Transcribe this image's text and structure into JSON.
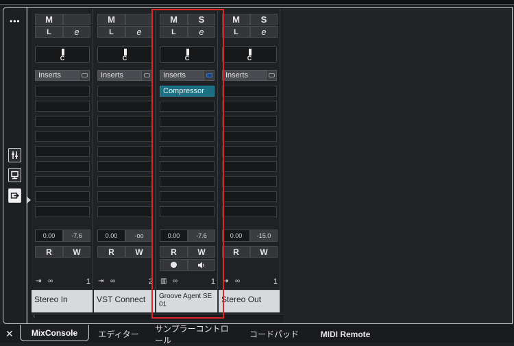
{
  "leftbar": {
    "menu_glyph": "•••",
    "buttons": [
      "eq-sliders-icon",
      "monitor-icon",
      "routing-icon"
    ]
  },
  "labels": {
    "mute": "M",
    "solo": "S",
    "listen": "L",
    "edit": "e",
    "read": "R",
    "write": "W",
    "inserts": "Inserts"
  },
  "channels": [
    {
      "name": "Stereo In",
      "pan": "C",
      "volume": "0.00",
      "peak": "-7.6",
      "number": "1",
      "type_icon": "input-icon",
      "has_solo": false,
      "plugin": "",
      "has_record": false
    },
    {
      "name": "VST Connect",
      "pan": "C",
      "volume": "0.00",
      "peak": "-oo",
      "number": "2",
      "type_icon": "input-icon",
      "has_solo": false,
      "plugin": "",
      "has_record": false
    },
    {
      "name": "Groove Agent SE 01",
      "pan": "C",
      "volume": "0.00",
      "peak": "-7.6",
      "number": "1",
      "type_icon": "instrument-icon",
      "has_solo": true,
      "plugin": "Compressor",
      "has_record": true
    },
    {
      "name": "Stereo Out",
      "pan": "C",
      "volume": "0.00",
      "peak": "-15.0",
      "number": "1",
      "type_icon": "output-icon",
      "has_solo": true,
      "plugin": "",
      "has_record": false
    }
  ],
  "tabs": [
    {
      "label": "MixConsole",
      "active": true
    },
    {
      "label": "エディター",
      "active": false
    },
    {
      "label": "サンプラーコントロール",
      "active": false
    },
    {
      "label": "コードパッド",
      "active": false
    },
    {
      "label": "MIDI Remote",
      "active": false
    }
  ],
  "colors": {
    "highlight": "#e32222",
    "plugin": "#1b6f80",
    "inserts_active": "#2d7bd6"
  }
}
